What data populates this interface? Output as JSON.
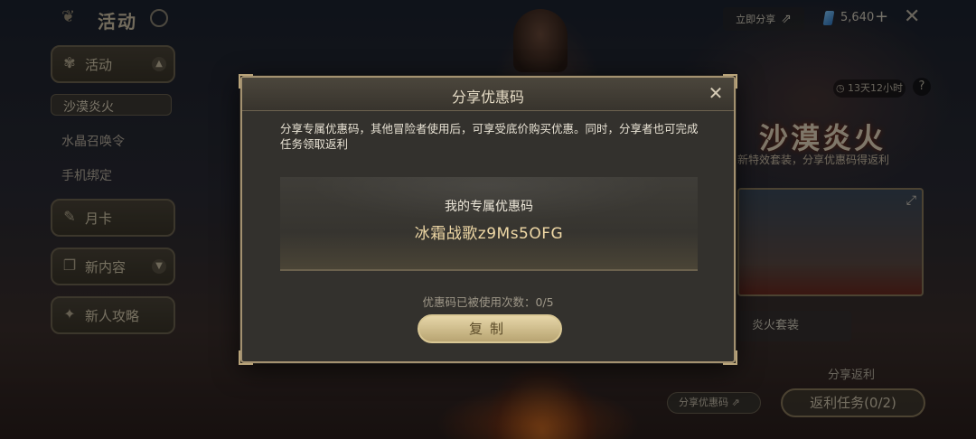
{
  "sidebar": {
    "title": "活动",
    "items": [
      {
        "label": "活动",
        "expanded": true
      },
      {
        "label": "月卡"
      },
      {
        "label": "新内容"
      },
      {
        "label": "新人攻略"
      }
    ],
    "subitems": [
      "沙漠炎火",
      "水晶召唤令",
      "手机绑定"
    ]
  },
  "hud": {
    "share_now": "立即分享",
    "gems": "5,640",
    "plus": "+",
    "close": "✕"
  },
  "event": {
    "timer": "13天12小时",
    "help": "?",
    "title": "沙漠炎火",
    "subtitle": "新特效套装，分享优惠码得返利",
    "set_tab": "炎火套装",
    "share_rebate": "分享返利",
    "share_code_btn": "分享优惠码",
    "rebate_task": "返利任务(0/2)"
  },
  "modal": {
    "title": "分享优惠码",
    "close": "✕",
    "description": "分享专属优惠码，其他冒险者使用后，可享受底价购买优惠。同时，分享者也可完成任务领取返利",
    "code_label": "我的专属优惠码",
    "code_value": "冰霜战歌z9Ms5OFG",
    "usage": "优惠码已被使用次数：0/5",
    "copy_button": "复制"
  }
}
